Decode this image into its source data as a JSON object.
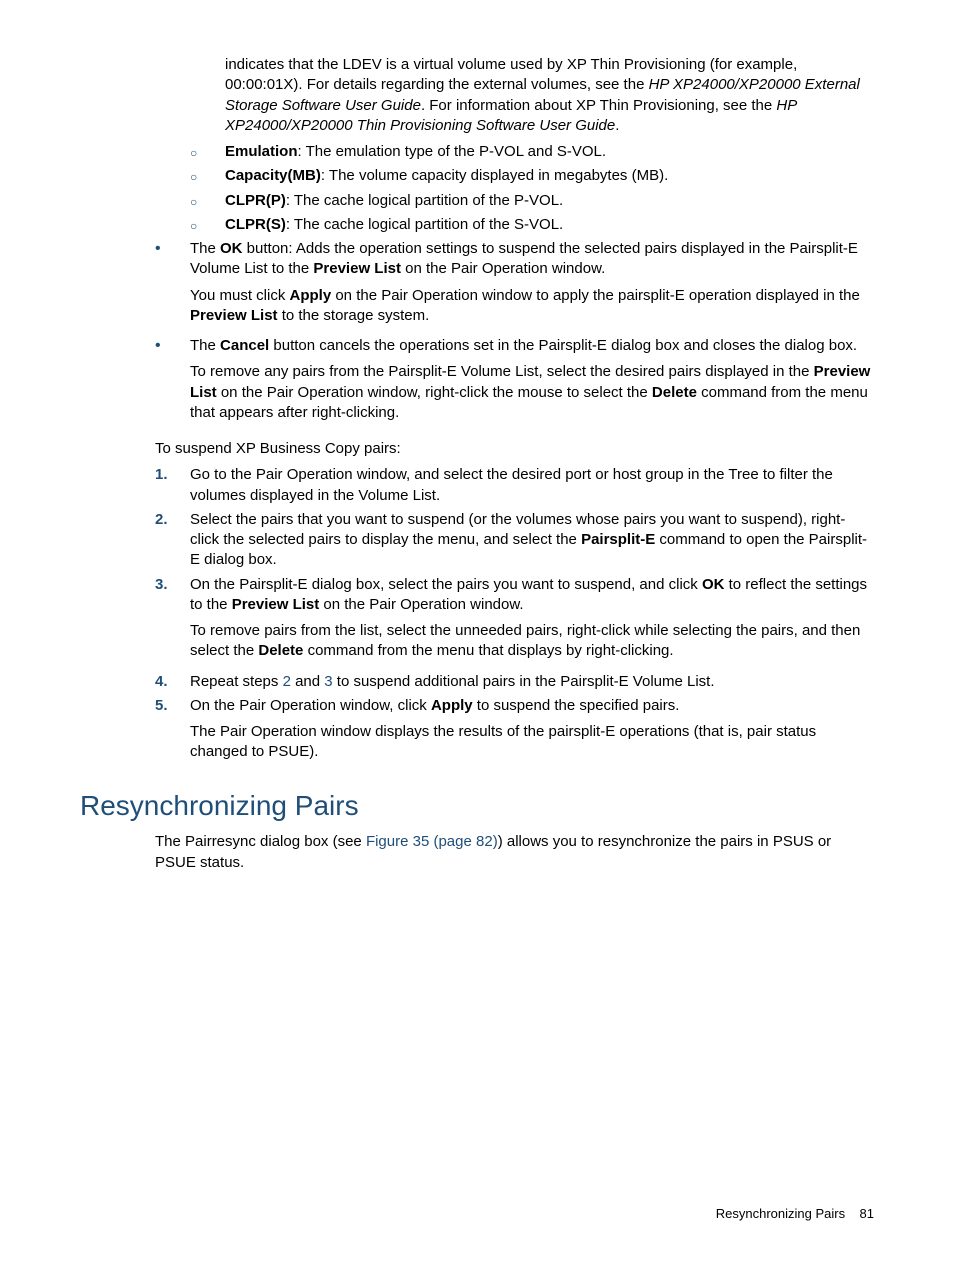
{
  "intro_para": {
    "p1_a": "indicates that the LDEV is a virtual volume used by XP Thin Provisioning (for example, 00:00:01X). For details regarding the external volumes, see the ",
    "p1_b": "HP XP24000/XP20000 External Storage Software User Guide",
    "p1_c": ". For information about XP Thin Provisioning, see the ",
    "p1_d": "HP XP24000/XP20000 Thin Provisioning Software User Guide",
    "p1_e": "."
  },
  "sublist": {
    "emulation_label": "Emulation",
    "emulation_text": ": The emulation type of the P-VOL and S-VOL.",
    "capacity_label": "Capacity(MB)",
    "capacity_text": ": The volume capacity displayed in megabytes (MB).",
    "clprp_label": "CLPR(P)",
    "clprp_text": ": The cache logical partition of the P-VOL.",
    "clprs_label": "CLPR(S)",
    "clprs_text": ": The cache logical partition of the S-VOL."
  },
  "ok_bullet": {
    "a": "The ",
    "b": "OK",
    "c": " button: Adds the operation settings to suspend the selected pairs displayed in the Pairsplit-E Volume List to the ",
    "d": "Preview List",
    "e": " on the Pair Operation window.",
    "f": "You must click ",
    "g": "Apply",
    "h": " on the Pair Operation window to apply the pairsplit-E operation displayed in the ",
    "i": "Preview List",
    "j": " to the storage system."
  },
  "cancel_bullet": {
    "a": "The ",
    "b": "Cancel",
    "c": " button cancels the operations set in the Pairsplit-E dialog box and closes the dialog box.",
    "d": "To remove any pairs from the Pairsplit-E Volume List, select the desired pairs displayed in the ",
    "e": "Preview List",
    "f": " on the Pair Operation window, right-click the mouse to select the ",
    "g": "Delete",
    "h": " command from the menu that appears after right-clicking."
  },
  "suspend_intro": "To suspend XP Business Copy pairs:",
  "steps": {
    "n1": "1.",
    "s1": "Go to the Pair Operation window, and select the desired port or host group in the Tree to filter the volumes displayed in the Volume List.",
    "n2": "2.",
    "s2a": "Select the pairs that you want to suspend (or the volumes whose pairs you want to suspend), right-click the selected pairs to display the menu, and select the ",
    "s2b": "Pairsplit-E",
    "s2c": " command to open the Pairsplit-E dialog box.",
    "n3": "3.",
    "s3a": "On the Pairsplit-E dialog box, select the pairs you want to suspend, and click ",
    "s3b": "OK",
    "s3c": " to reflect the settings to the ",
    "s3d": "Preview List",
    "s3e": " on the Pair Operation window.",
    "s3f": "To remove pairs from the list, select the unneeded pairs, right-click while selecting the pairs, and then select the ",
    "s3g": "Delete",
    "s3h": " command from the menu that displays by right-clicking.",
    "n4": "4.",
    "s4a": "Repeat steps ",
    "s4b": "2",
    "s4c": " and ",
    "s4d": "3",
    "s4e": " to suspend additional pairs in the Pairsplit-E Volume List.",
    "n5": "5.",
    "s5a": "On the Pair Operation window, click ",
    "s5b": "Apply",
    "s5c": " to suspend the specified pairs.",
    "s5d": "The Pair Operation window displays the results of the pairsplit-E operations (that is, pair status changed to PSUE)."
  },
  "section_heading": "Resynchronizing Pairs",
  "resync": {
    "a": "The Pairresync dialog box (see ",
    "b": "Figure 35 (page 82)",
    "c": ") allows you to resynchronize the pairs in PSUS or PSUE status."
  },
  "footer": {
    "label": "Resynchronizing Pairs",
    "page": "81"
  }
}
